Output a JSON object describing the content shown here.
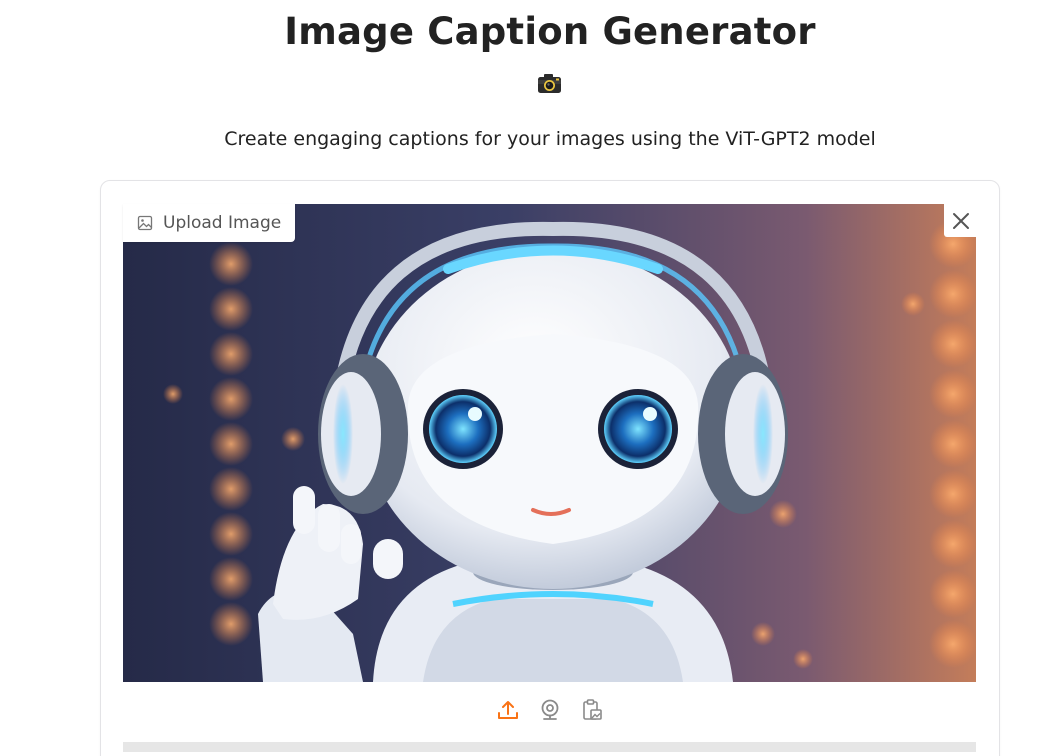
{
  "header": {
    "title": "Image Caption Generator",
    "subtitle": "Create engaging captions for your images using the ViT-GPT2 model",
    "emoji_icon": "camera-icon"
  },
  "image_input": {
    "label": "Upload Image",
    "label_icon": "image-icon",
    "close_icon": "close-icon",
    "sources": [
      {
        "name": "upload-icon",
        "active": true
      },
      {
        "name": "webcam-icon",
        "active": false
      },
      {
        "name": "clipboard-icon",
        "active": false
      }
    ]
  },
  "colors": {
    "accent": "#f97316",
    "text": "#222222",
    "muted": "#777777",
    "border": "#e3e3e6"
  }
}
